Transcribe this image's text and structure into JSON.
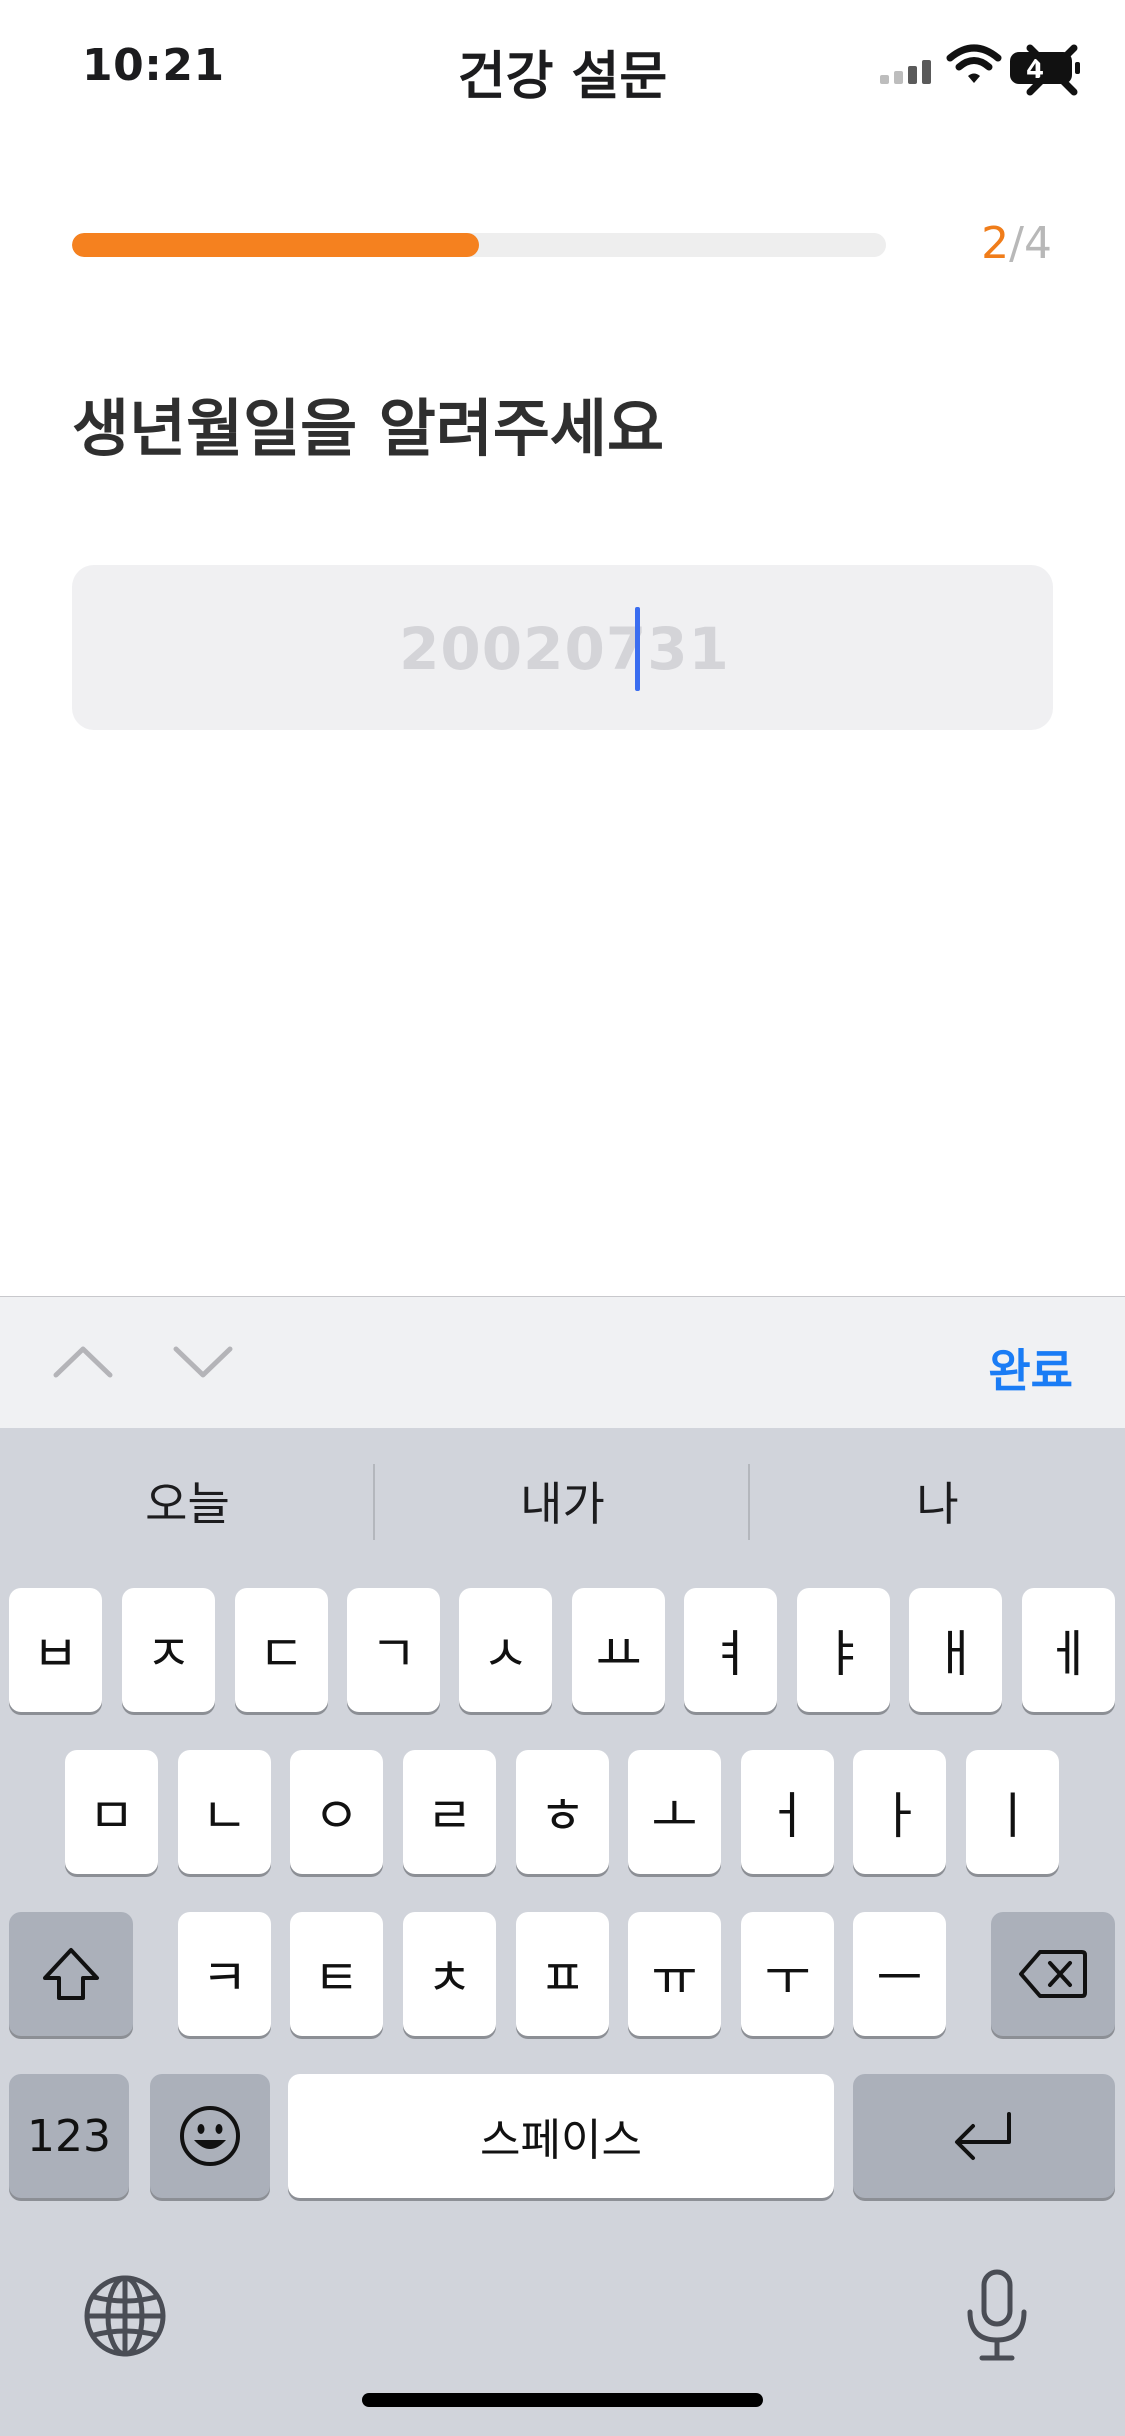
{
  "status_bar": {
    "time": "10:21",
    "battery": "4"
  },
  "header": {
    "title": "건강 설문"
  },
  "progress": {
    "current": "2",
    "separator": "/",
    "total": "4",
    "fill_fraction": 0.5
  },
  "question": {
    "title": "생년월일을 알려주세요"
  },
  "birthdate_input": {
    "placeholder": "20020731",
    "value": ""
  },
  "accessory": {
    "done_label": "완료"
  },
  "keyboard": {
    "suggestions": [
      "오늘",
      "내가",
      "나"
    ],
    "row1": [
      "ㅂ",
      "ㅈ",
      "ㄷ",
      "ㄱ",
      "ㅅ",
      "ㅛ",
      "ㅕ",
      "ㅑ",
      "ㅐ",
      "ㅔ"
    ],
    "row2": [
      "ㅁ",
      "ㄴ",
      "ㅇ",
      "ㄹ",
      "ㅎ",
      "ㅗ",
      "ㅓ",
      "ㅏ",
      "ㅣ"
    ],
    "row3": [
      "ㅋ",
      "ㅌ",
      "ㅊ",
      "ㅍ",
      "ㅠ",
      "ㅜ",
      "ㅡ"
    ],
    "numbers_label": "123",
    "space_label": "스페이스"
  },
  "icons": [
    "signal-icon",
    "wifi-icon",
    "battery-icon",
    "close-icon",
    "chevron-up-icon",
    "chevron-down-icon",
    "shift-icon",
    "backspace-icon",
    "emoji-icon",
    "return-icon",
    "globe-icon",
    "microphone-icon"
  ],
  "colors": {
    "accent": "#f5811f",
    "link": "#1a7cf5",
    "caret": "#3a6df0"
  }
}
